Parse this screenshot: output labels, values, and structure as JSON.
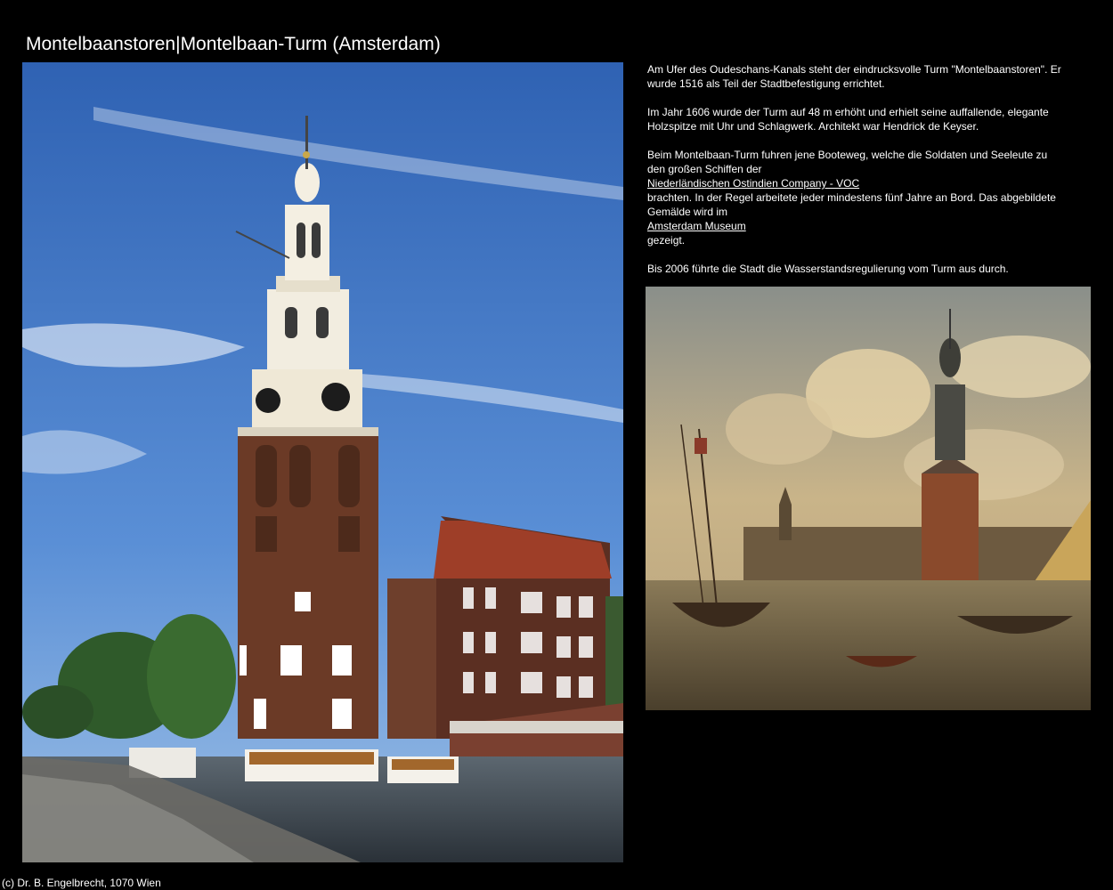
{
  "page": {
    "title": "Montelbaanstoren|Montelbaan-Turm (Amsterdam)"
  },
  "text": {
    "p1": "Am Ufer des Oudeschans-Kanals steht der eindrucksvolle Turm \"Montelbaanstoren\". Er wurde 1516 als Teil der Stadtbefestigung errichtet.",
    "p2": "Im Jahr 1606 wurde der Turm auf 48 m erhöht und erhielt seine auffallende, elegante Holzspitze mit Uhr und Schlagwerk. Architekt war Hendrick de Keyser.",
    "p3_intro": "Beim Montelbaan-Turm fuhren jene Booteweg, welche die Soldaten und Seeleute zu den großen Schiffen der",
    "p3_link1": "Niederländischen Ostindien Company - VOC",
    "p3_mid": "brachten. In der Regel arbeitete jeder mindestens fünf Jahre an Bord. Das abgebildete Gemälde wird im",
    "p3_link2": "Amsterdam Museum",
    "p3_end": "gezeigt.",
    "p4": "Bis 2006 führte die Stadt die Wasserstandsregulierung vom Turm aus durch."
  },
  "footer": {
    "copyright": "(c) Dr. B. Engelbrecht, 1070 Wien"
  },
  "colors": {
    "background": "#000000",
    "text": "#ffffff",
    "sky": "#3f74c4",
    "brick": "#6b3a26",
    "canal": "#4b5a66",
    "painting_sky": "#b7a37a"
  }
}
